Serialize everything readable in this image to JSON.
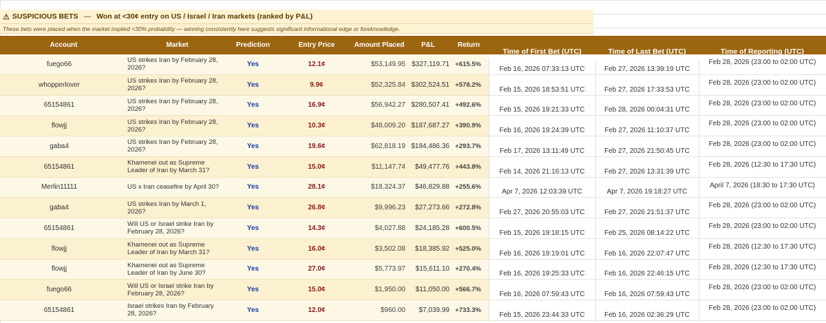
{
  "title": {
    "icon": "warning-icon",
    "label": "SUSPICIOUS BETS",
    "separator": "—",
    "description": "Won at <30¢ entry on US / Israel / Iran markets  (ranked by P&L)"
  },
  "subtitle": "These bets were placed when the market implied <30% probability — winning consistently here suggests significant informational edge or foreknowledge.",
  "headers": {
    "account": "Account",
    "market": "Market",
    "prediction": "Prediction",
    "entry_price": "Entry Price",
    "amount_placed": "Amount Placed",
    "pnl": "P&L",
    "return": "Return",
    "first_bet": "Time of First Bet (UTC)",
    "last_bet": "Time of Last Bet (UTC)",
    "reporting": "Time of Reporting (UTC)"
  },
  "colors": {
    "header_bg": "#9c6510",
    "title_bg": "#fdf2d2",
    "row_light": "#fdf7e6",
    "row_dark": "#fbf0cf",
    "prediction": "#1a3fa8",
    "entry_price": "#8b1a1a"
  },
  "rows": [
    {
      "account": "fuego66",
      "market": "US strikes Iran by February 28, 2026?",
      "prediction": "Yes",
      "entry": "12.1¢",
      "amount": "$53,149.95",
      "pnl": "$327,119.71",
      "ret": "+615.5%",
      "first": "Feb 16, 2026  07:33:13 UTC",
      "last": "Feb 27, 2026  13:39:19 UTC",
      "report": "Feb 28, 2026 (23:00 to 02:00 UTC)"
    },
    {
      "account": "whopperlover",
      "market": "US strikes Iran by February 28, 2026?",
      "prediction": "Yes",
      "entry": "9.9¢",
      "amount": "$52,325.84",
      "pnl": "$302,524.51",
      "ret": "+578.2%",
      "first": "Feb 15, 2026  18:53:51 UTC",
      "last": "Feb 27, 2026  17:33:53 UTC",
      "report": "Feb 28, 2026 (23:00 to 02:00 UTC)"
    },
    {
      "account": "65154861",
      "market": "US strikes Iran by February 28, 2026?",
      "prediction": "Yes",
      "entry": "16.9¢",
      "amount": "$56,942.27",
      "pnl": "$280,507.41",
      "ret": "+492.6%",
      "first": "Feb 15, 2026  19:21:33 UTC",
      "last": "Feb 28, 2026  00:04:31 UTC",
      "report": "Feb 28, 2026 (23:00 to 02:00 UTC)"
    },
    {
      "account": "flowjj",
      "market": "US strikes Iran by February 28, 2026?",
      "prediction": "Yes",
      "entry": "10.3¢",
      "amount": "$48,009.20",
      "pnl": "$187,687.27",
      "ret": "+390.9%",
      "first": "Feb 16, 2026  19:24:39 UTC",
      "last": "Feb 27, 2026  11:10:37 UTC",
      "report": "Feb 28, 2026 (23:00 to 02:00 UTC)"
    },
    {
      "account": "gaba4",
      "market": "US strikes Iran by February 28, 2026?",
      "prediction": "Yes",
      "entry": "19.6¢",
      "amount": "$62,818.19",
      "pnl": "$184,486.36",
      "ret": "+293.7%",
      "first": "Feb 17, 2026  13:11:49 UTC",
      "last": "Feb 27, 2026  21:50:45 UTC",
      "report": "Feb 28, 2026 (23:00 to 02:00 UTC)"
    },
    {
      "account": "65154861",
      "market": "Khamenei out as Supreme Leader of Iran by March 31?",
      "prediction": "Yes",
      "entry": "15.0¢",
      "amount": "$11,147.74",
      "pnl": "$49,477.76",
      "ret": "+443.8%",
      "first": "Feb 14, 2026  21:16:13 UTC",
      "last": "Feb 27, 2026  13:31:39 UTC",
      "report": "Feb 28, 2026 (12:30 to 17:30 UTC)"
    },
    {
      "account": "Merlin11111",
      "market": "US x Iran ceasefire by April 30?",
      "prediction": "Yes",
      "entry": "28.1¢",
      "amount": "$18,324.37",
      "pnl": "$46,829.88",
      "ret": "+255.6%",
      "first": "Apr 7, 2026  12:03:39 UTC",
      "last": "Apr 7, 2026  19:18:27 UTC",
      "report": "April 7, 2026 (18:30 to 17:30 UTC)"
    },
    {
      "account": "gaba4",
      "market": "US strikes Iran by March 1, 2026?",
      "prediction": "Yes",
      "entry": "26.8¢",
      "amount": "$9,996.23",
      "pnl": "$27,273.66",
      "ret": "+272.8%",
      "first": "Feb 27, 2026  20:55:03 UTC",
      "last": "Feb 27, 2026  21:51:37 UTC",
      "report": "Feb 28, 2026 (23:00 to 02:00 UTC)"
    },
    {
      "account": "65154861",
      "market": "Will US or Israel strike Iran by February 28, 2026?",
      "prediction": "Yes",
      "entry": "14.3¢",
      "amount": "$4,027.88",
      "pnl": "$24,185.28",
      "ret": "+600.5%",
      "first": "Feb 15, 2026  19:18:15 UTC",
      "last": "Feb 25, 2026  08:14:22 UTC",
      "report": "Feb 28, 2026 (23:00 to 02:00 UTC)"
    },
    {
      "account": "flowjj",
      "market": "Khamenei out as Supreme Leader of Iran by March 31?",
      "prediction": "Yes",
      "entry": "16.0¢",
      "amount": "$3,502.08",
      "pnl": "$18,385.92",
      "ret": "+525.0%",
      "first": "Feb 16, 2026  19:19:01 UTC",
      "last": "Feb 16, 2026  22:07:47 UTC",
      "report": "Feb 28, 2026 (12:30 to 17:30 UTC)"
    },
    {
      "account": "flowjj",
      "market": "Khamenei out as Supreme Leader of Iran by June 30?",
      "prediction": "Yes",
      "entry": "27.0¢",
      "amount": "$5,773.97",
      "pnl": "$15,611.10",
      "ret": "+270.4%",
      "first": "Feb 16, 2026  19:25:33 UTC",
      "last": "Feb 16, 2026  22:46:15 UTC",
      "report": "Feb 28, 2026 (12:30 to 17:30 UTC)"
    },
    {
      "account": "fuego66",
      "market": "Will US or Israel strike Iran by February 28, 2026?",
      "prediction": "Yes",
      "entry": "15.0¢",
      "amount": "$1,950.00",
      "pnl": "$11,050.00",
      "ret": "+566.7%",
      "first": "Feb 16, 2026  07:59:43 UTC",
      "last": "Feb 16, 2026  07:59:43 UTC",
      "report": "Feb 28, 2026 (23:00 to 02:00 UTC)"
    },
    {
      "account": "65154861",
      "market": "Israel strikes Iran by February 28, 2026?",
      "prediction": "Yes",
      "entry": "12.0¢",
      "amount": "$960.00",
      "pnl": "$7,039.99",
      "ret": "+733.3%",
      "first": "Feb 15, 2026  23:44:33 UTC",
      "last": "Feb 16, 2026  02:36:29 UTC",
      "report": "Feb 28, 2026 (23:00 to 02:00 UTC)"
    }
  ]
}
